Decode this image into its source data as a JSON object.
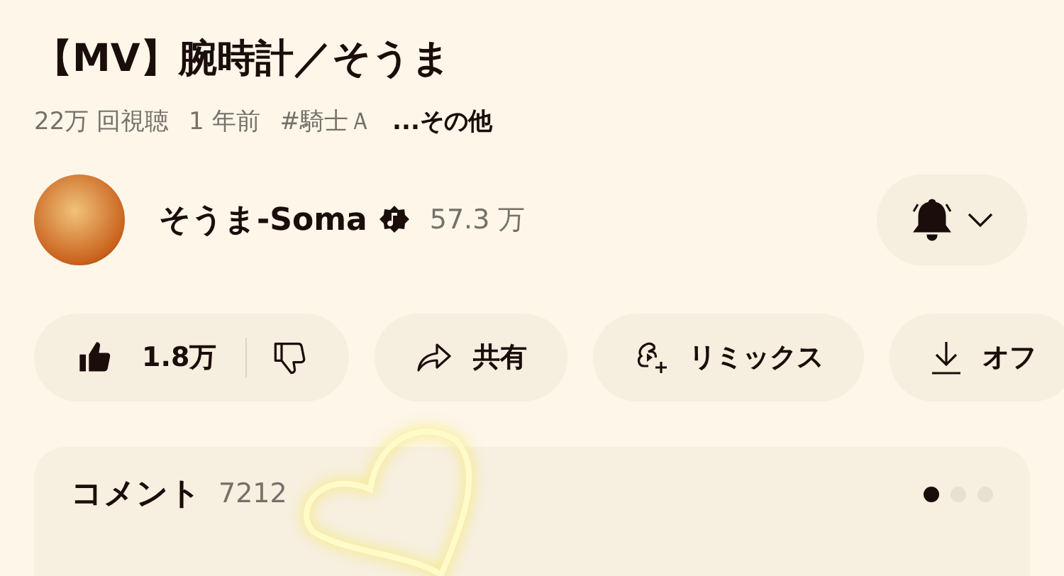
{
  "video": {
    "title": "【MV】腕時計／そうま",
    "meta": [
      "22万 回視聴",
      "1 年前",
      "#騎士Ａ"
    ],
    "more": "...その他"
  },
  "channel": {
    "name": "そうま-Soma",
    "verified": true,
    "subscribers": "57.3 万"
  },
  "actions": [
    {
      "kind": "like",
      "label": "1.8万"
    },
    {
      "kind": "share",
      "label": "共有"
    },
    {
      "kind": "remix",
      "label": "リミックス"
    },
    {
      "kind": "download",
      "label": "オフ"
    }
  ],
  "comments": {
    "title": "コメント",
    "count": "7212",
    "pages": [
      {
        "selected": true
      },
      {
        "selected": false
      },
      {
        "selected": false
      }
    ]
  }
}
